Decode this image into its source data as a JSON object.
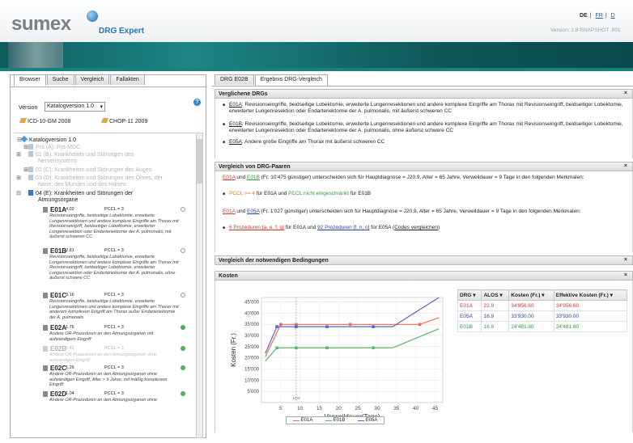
{
  "header": {
    "logo": "sumex",
    "product": "DRG Expert",
    "lang_de": "DE",
    "lang_fr": "FR",
    "lang_more": "D",
    "version_text": "Version: 1.8-SNAPSHOT .801"
  },
  "left": {
    "tabs": [
      "Browser",
      "Suche",
      "Vergleich",
      "Fallakten"
    ],
    "version_label": "Version",
    "version_value": "Katalogversion 1.0",
    "icd": "ICD-10-GM 2008",
    "chop": "CHOP-11 2009",
    "tree": {
      "root": "Katalogversion 1.0",
      "pre": "Prä (A): Prä-MDC",
      "c01": "01 (B): Krankheiten und Störungen des Nervensystems",
      "c02": "02 (C): Krankheiten und Störungen des Auges",
      "c03": "03 (D): Krankheiten und Störungen des Ohres, der Nase, des Mundes und des Halses",
      "c04": "04 (E): Krankheiten und Störungen der Atmungsorgane",
      "drgs": [
        {
          "code": "E01A",
          "weight": "4.02",
          "pccl": "PCCL = 3",
          "desc": "Revisionseingriffe, beidseitige Lobektomie, erweiterte Lungenresektionen und andere komplexe Eingriffe am Thorax mit Revisionseingriff, beidseitiger Lobektomie, erweiterter Lungenresektion oder Endarteriektomie der A. pulmonalis, mit äußerst schweren CC"
        },
        {
          "code": "E01B",
          "weight": "2.81",
          "pccl": "PCCL = 3",
          "desc": "Revisionseingriffe, beidseitige Lobektomie, erweiterte Lungenresektionen und andere komplexe Eingriffe am Thorax mit Revisionseingriff, beidseitiger Lobektomie, erweiterter Lungenresektion oder Endarteriektomie der A. pulmonalis, ohne äußerst schwere CC"
        },
        {
          "code": "E01C",
          "weight": "3.16",
          "pccl": "PCCL = 3",
          "desc": "Revisionseingriffe, beidseitige Lobektomie, erweiterte Lungenresektionen und andere komplexe Eingriffe am Thorax mit anderem komplexen Eingriff am Thorax außer Endarteriektomie der A. pulmonalis"
        },
        {
          "code": "E02A",
          "weight": "1.76",
          "pccl": "PCCL = 3",
          "desc": "Andere OR-Prozeduren an den Atmungsorganen mit aufwändigem Eingriff"
        },
        {
          "code": "E02B",
          "weight": "1.42",
          "pccl": "PCCL = 3",
          "desc": "Andere OR-Prozeduren an den Atmungsorganen ohne aufwändigen Eingriff"
        },
        {
          "code": "E02C",
          "weight": "1.26",
          "pccl": "PCCL = 3",
          "desc": "Andere OR-Prozeduren an den Atmungsorganen ohne aufwändigen Eingriff, Alter > 9 Jahre, mit mäßig komplexem Eingriff"
        },
        {
          "code": "E02D",
          "weight": "1.04",
          "pccl": "PCCL = 3",
          "desc": "Andere OR-Prozeduren an den Atmungsorganen ohne"
        }
      ]
    }
  },
  "right": {
    "tabs": [
      "DRG E02B",
      "Ergebnis DRG-Vergleich"
    ],
    "close": "×",
    "s1": {
      "title": "Verglichene DRGs",
      "items": [
        {
          "code": "E01A",
          "text": ": Revisionseingriffe, beidseitige Lobektomie, erweiterte Lungenresektionen und andere komplexe Eingriffe am Thorax mit Revisionseingriff, beidseitiger Lobektomie, erweiterter Lungenresektion oder Endarteriektomie der A. pulmonalis, mit äußerst schweren CC"
        },
        {
          "code": "E01B",
          "text": ": Revisionseingriffe, beidseitige Lobektomie, erweiterte Lungenresektionen und andere komplexe Eingriffe am Thorax mit Revisionseingriff, beidseitiger Lobektomie, erweiterter Lungenresektion oder Endarteriektomie der A. pulmonalis, ohne äußerst schwere CC"
        },
        {
          "code": "E05A",
          "text": ": Andere große Eingriffe am Thorax mit äußerst schweren CC"
        }
      ]
    },
    "s2": {
      "title": "Vergleich von DRG-Paaren",
      "p1_a": "E01A",
      "p1_und": " und ",
      "p1_b": "E01B",
      "p1_rest": " (Fr. 10'475 günstiger) unterscheiden sich für Hauptdiagnose = J20.9, Alter = 65 Jahre, Verweildauer = 9 Tage in den folgenden Merkmalen:",
      "p1_bullet_a": "PCCL >= 4",
      "p1_bullet_mid": " für E01A und ",
      "p1_bullet_b": "PCCL nicht eingeschränkt",
      "p1_bullet_end": " für E01B",
      "p2_a": "E01A",
      "p2_und": " und ",
      "p2_b": "E05A",
      "p2_rest": " (Fr. 1'027 günstiger) unterscheiden sich für Hauptdiagnose = J20.9, Alter = 65 Jahre, Verweildauer = 9 Tage in den folgenden Merkmalen:",
      "p2_bullet_a": "6 Prozeduren",
      "p2_bullet_a_list": " [a, e, f, g]",
      "p2_bullet_mid": " für E01A und ",
      "p2_bullet_b": "92 Prozeduren",
      "p2_bullet_b_list": " [f, n, o]",
      "p2_bullet_end": " für E05A (",
      "p2_link": "Codes vergleichen",
      "p2_close": ")"
    },
    "s3": {
      "title": "Vergleich der notwendigen Bedingungen"
    },
    "s4": {
      "title": "Kosten",
      "table": {
        "headers": [
          "DRG",
          "ALOS",
          "Kosten (Fr.)",
          "Effektive Kosten (Fr.)"
        ],
        "rows": [
          [
            "E01A",
            "22.9",
            "34'956.60",
            "34'956.60"
          ],
          [
            "E05A",
            "16.9",
            "33'930.00",
            "33'930.00"
          ],
          [
            "E01B",
            "16.9",
            "24'481.80",
            "24'481.80"
          ]
        ]
      }
    }
  },
  "colors": {
    "E01A": "#e8705a",
    "E01B": "#5cb86a",
    "E05A": "#5a64c8"
  },
  "chart_data": {
    "type": "line",
    "xlabel": "Verweildauer(Tage)",
    "ylabel": "Kosten (Fr.)",
    "xlim": [
      0,
      47
    ],
    "ylim": [
      0,
      47000
    ],
    "xticks": [
      5,
      10,
      15,
      20,
      25,
      30,
      35,
      40,
      45
    ],
    "yticks": [
      5000,
      10000,
      15000,
      20000,
      25000,
      30000,
      35000,
      40000,
      45000
    ],
    "ytick_labels": [
      "5'000",
      "10'000",
      "15'000",
      "20'000",
      "25'000",
      "30'000",
      "35'000",
      "40'000",
      "45'000"
    ],
    "marker_label": "LOS",
    "marker_x": 9,
    "legend": "bottom",
    "series": [
      {
        "name": "E01A",
        "x": [
          1,
          5,
          9,
          17,
          23,
          29,
          35,
          41,
          46
        ],
        "y": [
          20500,
          34956,
          34956,
          34956,
          34956,
          34956,
          34956,
          34956,
          38000
        ],
        "markers": [
          5,
          9,
          23,
          41
        ]
      },
      {
        "name": "E01B",
        "x": [
          1,
          4,
          9,
          17,
          29,
          34,
          46
        ],
        "y": [
          18500,
          24481,
          24481,
          24481,
          24481,
          24481,
          33000
        ],
        "markers": [
          4,
          9,
          17,
          29
        ]
      },
      {
        "name": "E05A",
        "x": [
          1,
          4,
          9,
          17,
          29,
          34,
          46
        ],
        "y": [
          22000,
          33930,
          33930,
          33930,
          33930,
          33930,
          47000
        ],
        "markers": [
          4,
          9,
          17,
          29
        ]
      }
    ]
  }
}
